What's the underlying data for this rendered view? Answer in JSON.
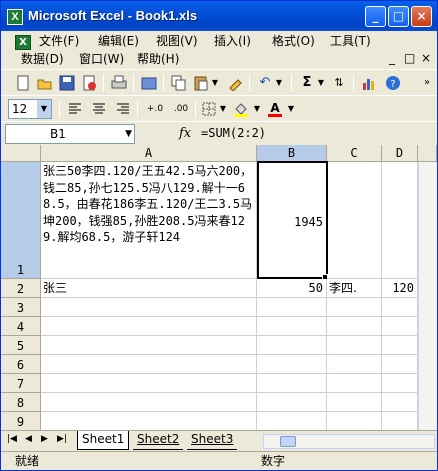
{
  "window": {
    "title": "Microsoft Excel - Book1.xls",
    "app_icon": "X"
  },
  "titlebar_buttons": {
    "minimize": "_",
    "maximize": "□",
    "close": "×"
  },
  "menu": {
    "items": [
      "文件(F)",
      "编辑(E)",
      "视图(V)",
      "插入(I)",
      "格式(O)",
      "工具(T)",
      "数据(D)",
      "窗口(W)",
      "帮助(H)"
    ],
    "right_controls": [
      "_",
      "□",
      "×"
    ]
  },
  "toolbar1": {
    "icons": [
      "new-icon",
      "open-icon",
      "save-icon",
      "permission-icon",
      "print-icon",
      "research-icon",
      "copy-icon",
      "paste-icon",
      "format-painter-icon",
      "undo-icon",
      "autosum-icon",
      "sort-icon",
      "chart-icon",
      "help-icon"
    ],
    "sigma": "Σ"
  },
  "toolbar2": {
    "font_size": "12",
    "increase_decimal": "+.0",
    "decrease_decimal": ".00"
  },
  "formula_bar": {
    "name_box": "B1",
    "fx": "fx",
    "formula": "=SUM(2:2)"
  },
  "sheet": {
    "columns": [
      "A",
      "B",
      "C",
      "D"
    ],
    "rows": [
      "1",
      "2",
      "3",
      "4",
      "5",
      "6",
      "7",
      "8",
      "9"
    ],
    "cells": {
      "A1": "张三50李四.120/王五42.5马六200，钱二85,孙七125.5冯八129.解十一68.5，由春花186李五.120/王二3.5马坤200，钱强85,孙胜208.5冯来春129.解均68.5，游子轩124",
      "B1": "1945",
      "A2": "张三",
      "B2": "50",
      "C2": "李四.",
      "D2": "120"
    },
    "selected_cell": "B1"
  },
  "tabs": {
    "nav": [
      "|◀",
      "◀",
      "▶",
      "▶|"
    ],
    "sheets": [
      "Sheet1",
      "Sheet2",
      "Sheet3"
    ],
    "active": "Sheet1"
  },
  "status": {
    "left": "就绪",
    "right": "数字"
  }
}
